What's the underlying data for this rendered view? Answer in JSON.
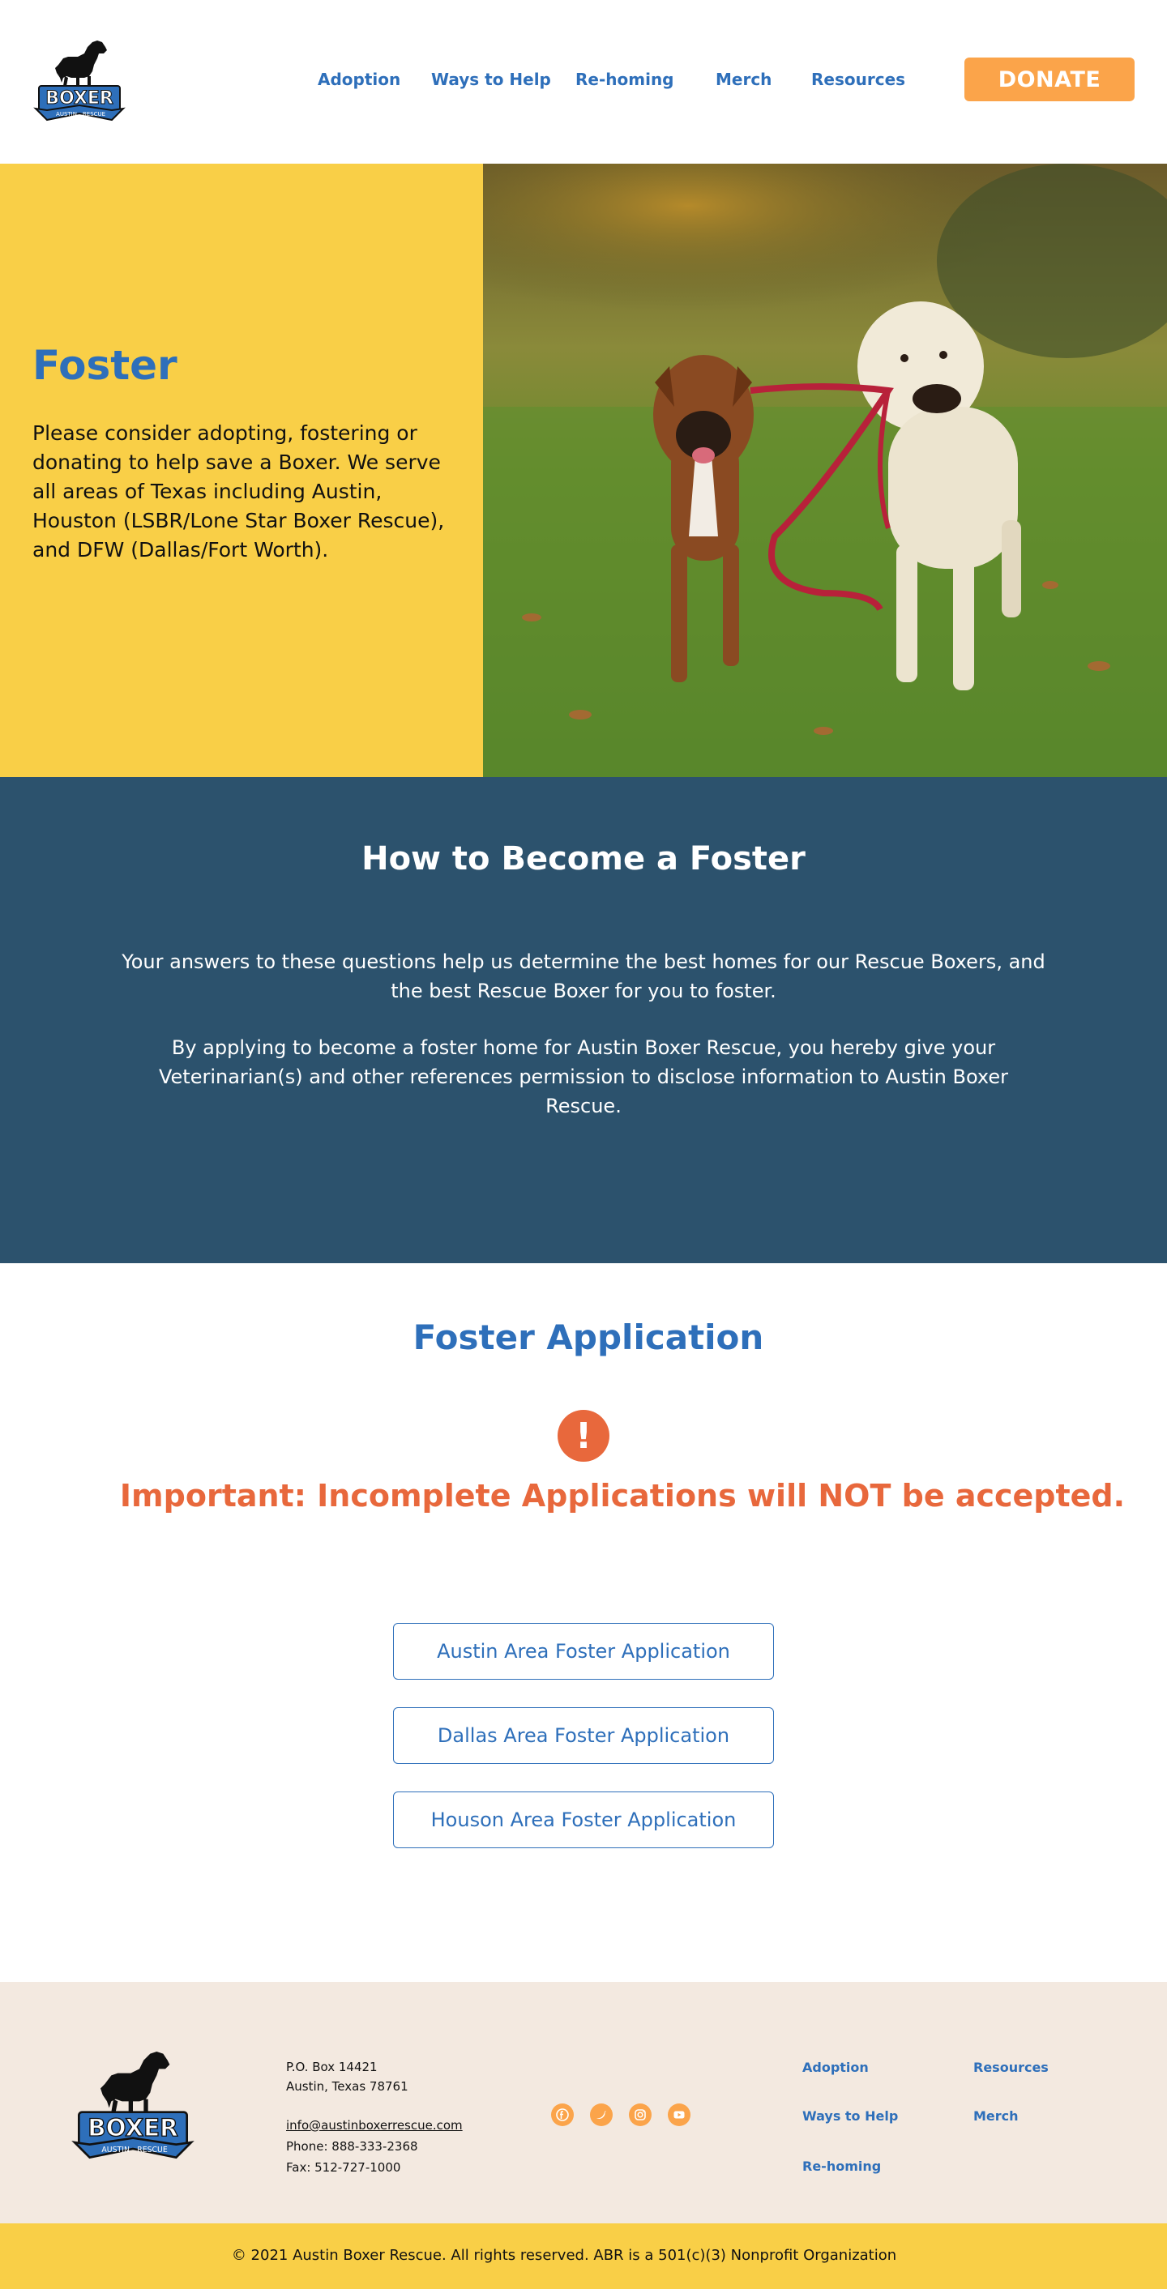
{
  "brand": {
    "logo_word": "BOXER",
    "logo_left": "AUSTIN",
    "logo_right": "RESCUE",
    "primary_color": "#2e6fba",
    "accent_color": "#fba44a",
    "yellow": "#f9cf47",
    "navy": "#2c526d",
    "alert_color": "#e8683c"
  },
  "nav": {
    "items": [
      "Adoption",
      "Ways to Help",
      "Re-homing",
      "Merch",
      "Resources"
    ],
    "donate": "DONATE"
  },
  "hero": {
    "title": "Foster",
    "text": "Please consider adopting, fostering or donating to help save a Boxer. We serve all areas of Texas including Austin, Houston (LSBR/Lone Star Boxer Rescue), and DFW (Dallas/Fort Worth)."
  },
  "how": {
    "title": "How to Become a Foster",
    "p1": "Your answers to these questions help us determine the best homes for our Rescue Boxers, and the best Rescue Boxer for you to foster.",
    "p2": "By applying to become a foster home for Austin Boxer Rescue, you hereby give your Veterinarian(s) and other references permission to disclose information to Austin Boxer Rescue."
  },
  "application": {
    "title": "Foster Application",
    "alert_icon": "exclamation-icon",
    "important": "Important: Incomplete Applications will NOT be accepted.",
    "buttons": [
      "Austin Area Foster Application",
      "Dallas Area Foster Application",
      "Houson Area Foster Application"
    ]
  },
  "footer": {
    "address_line1": "P.O. Box 14421",
    "address_line2": "Austin, Texas 78761",
    "email": "info@austinboxerrescue.com",
    "phone": "Phone: 888-333-2368",
    "fax": "Fax: 512-727-1000",
    "social": [
      "facebook-icon",
      "twitter-icon",
      "instagram-icon",
      "youtube-icon"
    ],
    "links": [
      "Adoption",
      "Resources",
      "Ways to Help",
      "Merch",
      "Re-homing"
    ],
    "copyright": "© 2021 Austin Boxer Rescue. All rights reserved. ABR is a 501(c)(3) Nonprofit Organization"
  }
}
